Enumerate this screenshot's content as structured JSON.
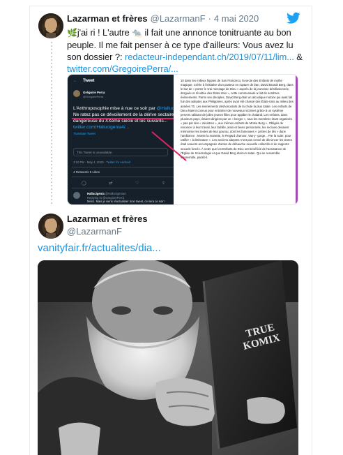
{
  "tweet_main": {
    "name": "Lazarman et frères",
    "handle": "@LazarmanF",
    "separator": "·",
    "date": "4 mai 2020",
    "text_part1": "j'ai ri ! L'autre ",
    "text_part2": " il fait une annonce tonitruante au bon peuple. Il me fait penser à ce type d'ailleurs: Vous avez lu son dossier ?: ",
    "link1": "redacteur-independant.ch/2019/07/11/lim...",
    "amp": " &",
    "link2": "twitter.com/GregoirePerra/...",
    "emoji_leaf": "🌿",
    "emoji_mouse": "🐀"
  },
  "embedded_screenshot": {
    "header": "Tweet",
    "author_name": "Grégoire Perra",
    "author_handle": "@GregoirePerra",
    "text_line1": "L'Anthroposophie mise à nue ce soir par ",
    "text_mention": "@Halluc",
    "text_line2": "! Ne ratez pas ce dévoilement de la dérive sectaire dangereuse du XXème siècle et les suivants...",
    "text_link": "twitter.com/Hallucigenia4/...",
    "translate": "Translate Tweet",
    "unavailable": "This Tweet is unavailable.",
    "meta_time": "3:10 PM · May 4, 2020 · ",
    "meta_client": "Twitter for Android",
    "stats": "4 Retweets  6 Likes",
    "reply_name": "Hallucigenia",
    "reply_handle": "@Hallucigenia4",
    "reply_to": "Replying to @GregoirePerra",
    "reply_text": "Merci. Mais je viens réactualiser mon tweet, ce sera ce soir !",
    "article_text": "10 dans les milieux hippies de San Francisco, la secte des Enfants de mythe magique. Créée à l'initiative d'un pasteur en rupture de ban, David Brandt Berg, dans le but de « porter le vrai message de Dieu » auprès de la jeunesse désillusionnée, droguée et révoltée des États-Unis », cette communauté a fait de sombres événements. Parmi ses disciples, David Berg était un alcoolique notoire qui avait fait fuir des adeptes aux Philippines, après avoir été chassé des États-Unis au milieu des années 70. Les événements déshonorants de la chute la plus totale. Les enfants de Dieu étaient connus pour entraîner de nouveaux victimes grâce à un système pervers utilisant de jolies jeunes filles pour appâter le chaland. Les enfants, dans plusieurs pays, étaient dirigées par un « berger », tous les membres étant organisés « pas par des « ministres », aux mêmes enfants de Moïse Berg ». Obligés de renoncer à leur travail, leur famille, amis et biens personnels, les recrues devaient mémoriser les textes de leur gourou, dont les fameuses « Lettres de Mo » dans l'ambiance : Monte la manette, le Regard d'amour, Vas-y -gorge... Par la suite, pour ratifier « la littérature ». Les anciens adeptes n'ont pas cessé de dénoncer les textes était souvent accompagnée d'actes de débauche sexuelle collectifs et de rapports sexuels forcés. À noter que les Enfants de Dieu ont bénéficié de l'assistance de l'Église de Scientologie et que David Berg était un satan. Qui se ressemble s'assemble, paraît-il."
  },
  "tweet_quoted": {
    "name": "Lazarman et frères",
    "handle": "@LazarmanF",
    "link": "vanityfair.fr/actualites/dia...",
    "book_title_line1": "TRUE",
    "book_title_line2": "KOMIX"
  },
  "colors": {
    "link": "#1b95e0",
    "twitter_blue": "#1da1f2",
    "dark_bg": "#15202b",
    "accent_red": "#e0245e"
  },
  "icons": [
    "twitter-bird-icon",
    "back-arrow-icon",
    "reply-icon",
    "retweet-icon",
    "like-icon",
    "share-icon"
  ]
}
